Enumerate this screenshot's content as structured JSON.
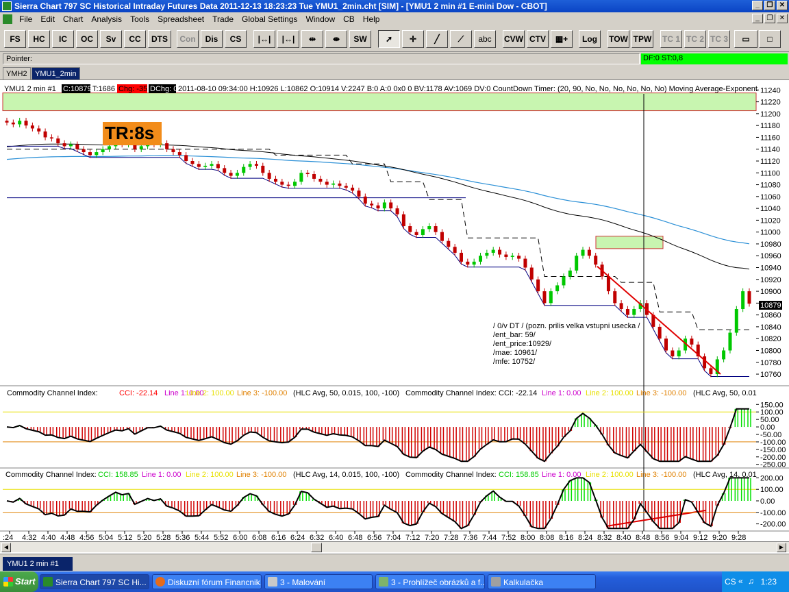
{
  "window": {
    "title": "Sierra Chart 797 SC Historical Intraday Futures Data 2011-12-13  18:23:23 Tue  YMU1_2min.cht [SIM] - [YMU1  2 min   #1  E-mini Dow - CBOT]"
  },
  "menu": [
    "File",
    "Edit",
    "Chart",
    "Analysis",
    "Tools",
    "Spreadsheet",
    "Trade",
    "Global Settings",
    "Window",
    "CB",
    "Help"
  ],
  "toolbar": {
    "text_buttons": [
      "FS",
      "HC",
      "IC",
      "OC",
      "Sv",
      "CC",
      "DTS",
      "Con",
      "Dis",
      "CS"
    ],
    "sw_label": "SW",
    "abc_label": "abc",
    "cvw_label": "CVW",
    "ctv_label": "CTV",
    "log_label": "Log",
    "tow_label": "TOW",
    "tpw_label": "TPW",
    "tc_labels": [
      "TC 1",
      "TC 2",
      "TC 3"
    ]
  },
  "pointer": {
    "label": "Pointer:",
    "df_st": "DF:0  ST:0,8"
  },
  "tabs": [
    "YMH2",
    "YMU1_2min"
  ],
  "chart_header": {
    "symbol": "YMU1  2 min   #1",
    "close": "C:10879",
    "ticks": "T:1686",
    "chg": "Chg: -35",
    "dchg": "DChg: 0",
    "rest": "2011-08-10 09:34:00 H:10926 L:10862 O:10914 V:2247 B:0 A:0 0x0 0 BV:1178 AV:1069 DV:0 CountDown Timer:   (20, 90, No, No, No, No, No, No)  Moving Average-Exponent"
  },
  "tr_label": "TR:8s",
  "annotation_lines": [
    "/ 0/v DT / (pozn. prilis velka vstupni usecka /",
    "/ent_bar: 59/",
    "/ent_price:10929/",
    "/mae: 10961/",
    "/mfe: 10752/"
  ],
  "price_badge": "10879",
  "cci1_header": {
    "name": "Commodity Channel Index:",
    "cci": "CCI: -22.14",
    "l1": "Line 1: 0.00",
    "l2": "Line 2: 100.00",
    "l3": "Line 3: -100.00",
    "params": "(HLC Avg, 50, 0.015, 100, -100)",
    "name2": "Commodity Channel Index:",
    "cci2": "CCI: -22.14",
    "l1b": "Line 1: 0.00",
    "l2b": "Line 2: 100.00",
    "l3b": "Line 3: -100.00",
    "params2": "(HLC Avg, 50, 0.01"
  },
  "cci2_header": {
    "name": "Commodity Channel Index:",
    "cci": "CCI: 158.85",
    "l1": "Line 1: 0.00",
    "l2": "Line 2: 100.00",
    "l3": "Line 3: -100.00",
    "params": "(HLC Avg, 14, 0.015, 100, -100)",
    "name2": "Commodity Channel Index:",
    "cci2": "CCI: 158.85",
    "l1b": "Line 1: 0.00",
    "l2b": "Line 2: 100.00",
    "l3b": "Line 3: -100.00",
    "params2": "(HLC Avg, 14, 0.01"
  },
  "chart_data": {
    "type": "candlestick",
    "price_axis_ticks": [
      11240,
      11220,
      11200,
      11180,
      11160,
      11140,
      11120,
      11100,
      11080,
      11060,
      11040,
      11020,
      11000,
      10980,
      10960,
      10940,
      10920,
      10900,
      10880,
      10860,
      10840,
      10820,
      10800,
      10780,
      10760
    ],
    "price_range": [
      10745,
      11245
    ],
    "cci1_ticks": [
      "150.00",
      "100.00",
      "50.00",
      "0.00",
      "-50.00",
      "-100.00",
      "-150.00",
      "-200.00",
      "-250.00"
    ],
    "cci2_ticks": [
      "200.00",
      "100.00",
      "0.00",
      "-100.00",
      "-200.00"
    ],
    "time_labels": [
      ":24",
      "4:32",
      "4:40",
      "4:48",
      "4:56",
      "5:04",
      "5:12",
      "5:20",
      "5:28",
      "5:36",
      "5:44",
      "5:52",
      "6:00",
      "6:08",
      "6:16",
      "6:24",
      "6:32",
      "6:40",
      "6:48",
      "6:56",
      "7:04",
      "7:12",
      "7:20",
      "7:28",
      "7:36",
      "7:44",
      "7:52",
      "8:00",
      "8:08",
      "8:16",
      "8:24",
      "8:32",
      "8:40",
      "8:48",
      "8:56",
      "9:04",
      "9:12",
      "9:20",
      "9:28"
    ],
    "close_path": [
      11185,
      11182,
      11188,
      11180,
      11175,
      11170,
      11160,
      11158,
      11150,
      11145,
      11148,
      11140,
      11135,
      11130,
      11135,
      11140,
      11145,
      11150,
      11148,
      11152,
      11140,
      11145,
      11150,
      11148,
      11150,
      11140,
      11135,
      11130,
      11120,
      11115,
      11110,
      11112,
      11115,
      11108,
      11100,
      11095,
      11100,
      11110,
      11115,
      11112,
      11100,
      11090,
      11085,
      11080,
      11078,
      11085,
      11100,
      11098,
      11090,
      11085,
      11080,
      11082,
      11078,
      11075,
      11070,
      11060,
      11048,
      11045,
      11040,
      11050,
      11040,
      11030,
      11010,
      11000,
      10995,
      11005,
      11010,
      11000,
      10985,
      10975,
      10965,
      10950,
      10945,
      10950,
      10960,
      10965,
      10970,
      10962,
      10958,
      10960,
      10955,
      10940,
      10920,
      10900,
      10880,
      10900,
      10910,
      10925,
      10935,
      10960,
      10970,
      10960,
      10945,
      10925,
      10900,
      10880,
      10870,
      10860,
      10870,
      10880,
      10860,
      10840,
      10820,
      10800,
      10790,
      10800,
      10820,
      10810,
      10790,
      10770,
      10760,
      10785,
      10800,
      10830,
      10870,
      10900,
      10879
    ],
    "ema_levels": {
      "dashed_start": 11140,
      "black_start": 11143,
      "blue_start": 11130,
      "navy_level": 11058
    }
  },
  "taskbar": {
    "start": "Start",
    "items": [
      "Sierra Chart 797 SC Hi...",
      "Diskuzní fórum Financnik....",
      "3 - Malování",
      "3 - Prohlížeč obrázků a f...",
      "Kalkulačka"
    ],
    "clock": "1:23"
  },
  "bottom_tab": "YMU1  2 min   #1"
}
